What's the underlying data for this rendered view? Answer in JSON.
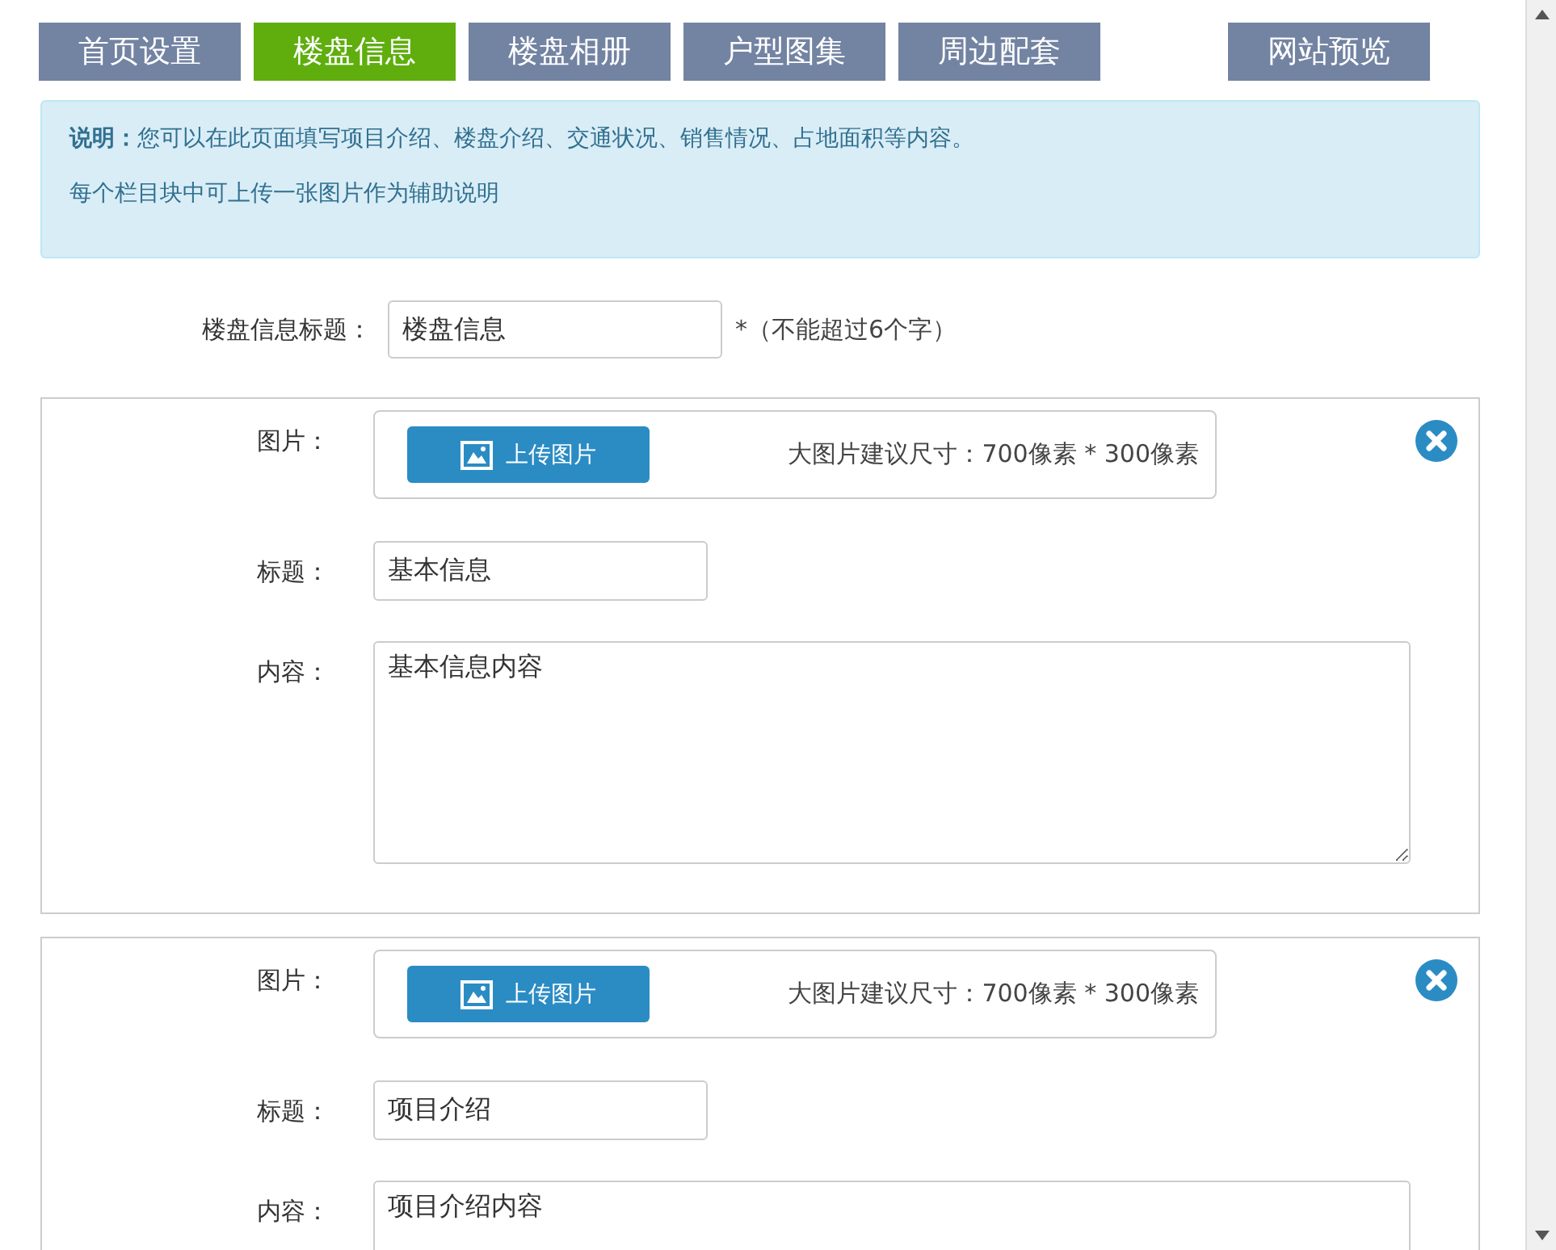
{
  "tabs": [
    {
      "label": "首页设置",
      "selected": false
    },
    {
      "label": "楼盘信息",
      "selected": true
    },
    {
      "label": "楼盘相册",
      "selected": false
    },
    {
      "label": "户型图集",
      "selected": false
    },
    {
      "label": "周边配套",
      "selected": false
    }
  ],
  "preview_button": "网站预览",
  "notice": {
    "lines": [
      "**说明：**您可以在此页面填写项目介绍、楼盘介绍、交通状况、销售情况、占地面积等内容。",
      "每个栏目块中可上传一张图片作为辅助说明"
    ]
  },
  "page_title": {
    "label": "楼盘信息标题：",
    "value": "楼盘信息",
    "hint": "*（不能超过6个字）"
  },
  "blocks": [
    {
      "image_label": "图片：",
      "upload_button": "上传图片",
      "size_hint": "大图片建议尺寸：700像素 * 300像素",
      "title_label": "标题：",
      "title": "基本信息",
      "content_label": "内容：",
      "content": "基本信息内容"
    },
    {
      "image_label": "图片：",
      "upload_button": "上传图片",
      "size_hint": "大图片建议尺寸：700像素 * 300像素",
      "title_label": "标题：",
      "title": "项目介绍",
      "content_label": "内容：",
      "content": "项目介绍内容"
    }
  ]
}
